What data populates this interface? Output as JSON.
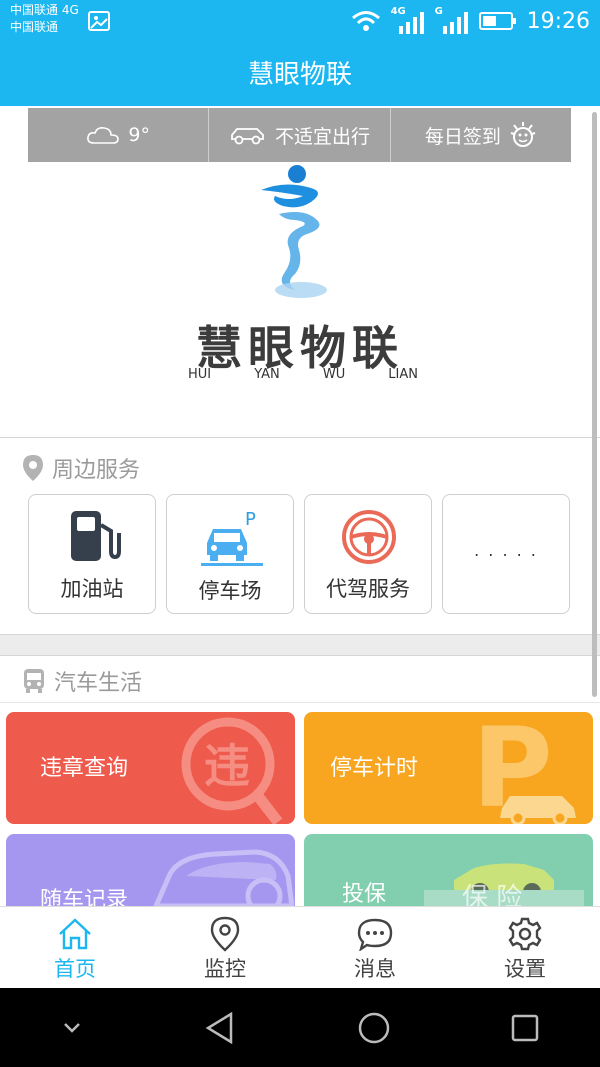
{
  "status_bar": {
    "carrier_line1": "中国联通 4G",
    "carrier_line2": "中国联通",
    "net1": "4G",
    "net2": "G",
    "time": "19:26"
  },
  "header": {
    "title": "慧眼物联"
  },
  "quick_bar": {
    "weather": "9°",
    "travel": "不适宜出行",
    "checkin": "每日签到"
  },
  "logo": {
    "name": "慧眼物联",
    "pinyin": [
      "HUI",
      "YAN",
      "WU",
      "LIAN"
    ]
  },
  "nearby": {
    "title": "周边服务",
    "items": [
      {
        "label": "加油站",
        "icon": "gas-station-icon"
      },
      {
        "label": "停车场",
        "icon": "parking-car-icon"
      },
      {
        "label": "代驾服务",
        "icon": "steering-wheel-icon"
      },
      {
        "label": ". . . . .",
        "icon": "more-icon"
      }
    ]
  },
  "car_life": {
    "title": "汽车生活",
    "tiles": [
      {
        "label": "违章查询",
        "color": "#ee5a4b"
      },
      {
        "label": "停车计时",
        "color": "#f8a51f"
      },
      {
        "label": "随车记录",
        "color": "#a597ef"
      },
      {
        "label": "投保",
        "color": "#82cfb0"
      }
    ]
  },
  "tabs": [
    {
      "label": "首页",
      "icon": "home-icon",
      "active": true
    },
    {
      "label": "监控",
      "icon": "location-pin-icon"
    },
    {
      "label": "消息",
      "icon": "chat-bubble-icon"
    },
    {
      "label": "设置",
      "icon": "gear-icon"
    }
  ],
  "colors": {
    "brand": "#1cb7f0",
    "quick_bar": "#a3a3a3"
  }
}
